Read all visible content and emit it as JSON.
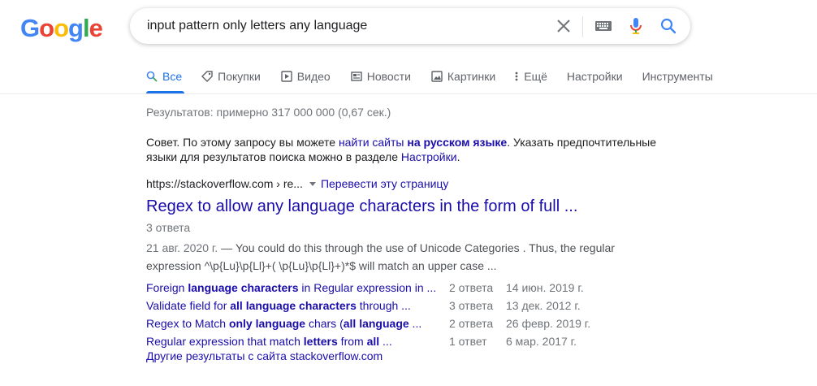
{
  "logo": {
    "letters": [
      "G",
      "o",
      "o",
      "g",
      "l",
      "e"
    ],
    "colors": [
      "#4285F4",
      "#EA4335",
      "#FBBC05",
      "#4285F4",
      "#34A853",
      "#EA4335"
    ]
  },
  "search": {
    "query": "input pattern only letters any language"
  },
  "icons": {
    "clear": "close-icon",
    "keyboard": "keyboard-icon",
    "voice": "microphone-icon",
    "search": "search-icon"
  },
  "tabs": [
    {
      "label": "Все",
      "icon": "search-icon",
      "active": true
    },
    {
      "label": "Покупки",
      "icon": "tag-icon"
    },
    {
      "label": "Видео",
      "icon": "play-icon"
    },
    {
      "label": "Новости",
      "icon": "newspaper-icon"
    },
    {
      "label": "Картинки",
      "icon": "image-icon"
    },
    {
      "label": "Ещё",
      "icon": "more-vert-icon"
    },
    {
      "label": "Настройки"
    },
    {
      "label": "Инструменты"
    }
  ],
  "stats": "Результатов: примерно 317 000 000 (0,67 сек.)",
  "tip": {
    "prefix": "Совет. По этому запросу вы можете ",
    "link1": "найти сайты",
    "space": " ",
    "link2": "на русском языке",
    "middle": ". Указать предпочтительные языки для результатов поиска можно в разделе ",
    "link3": "Настройки",
    "suffix": "."
  },
  "result": {
    "url": "https://stackoverflow.com › re...",
    "translate": "Перевести эту страницу",
    "title": "Regex to allow any language characters in the form of full ...",
    "answers": "3 ответа",
    "date": "21 авг. 2020 г.",
    "snippet": " — You could do this through the use of Unicode Categories . Thus, the regular expression ^\\p{Lu}\\p{Ll}+( \\p{Lu}\\p{Ll}+)*$ will match an upper case ...",
    "related": [
      {
        "parts": [
          "Foreign ",
          "language characters",
          " in Regular expression in ..."
        ],
        "count": "2 ответа",
        "date": "14 июн. 2019 г."
      },
      {
        "parts": [
          "Validate field for ",
          "all language characters",
          " through ..."
        ],
        "count": "3 ответа",
        "date": "13 дек. 2012 г."
      },
      {
        "parts": [
          "Regex to Match ",
          "only language",
          " chars (",
          "all language",
          " ..."
        ],
        "count": "2 ответа",
        "date": "26 февр. 2019 г."
      },
      {
        "parts": [
          "Regular expression that match ",
          "letters",
          " from ",
          "all",
          " ..."
        ],
        "count": "1 ответ",
        "date": "6 мар. 2017 г."
      }
    ],
    "more": "Другие результаты с сайта stackoverflow.com"
  }
}
